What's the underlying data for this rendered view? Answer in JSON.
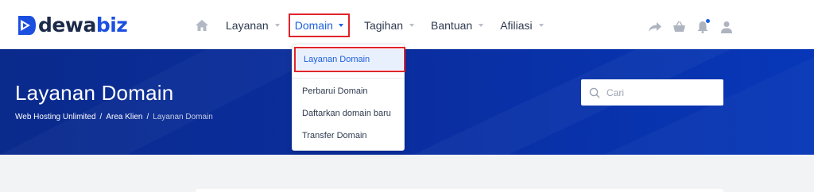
{
  "brand": {
    "name_part1": "dewa",
    "name_part2": "biz",
    "icon": "dewabiz-play-logo"
  },
  "nav": {
    "home_icon": "home-icon",
    "items": [
      {
        "label": "Layanan"
      },
      {
        "label": "Domain"
      },
      {
        "label": "Tagihan"
      },
      {
        "label": "Bantuan"
      },
      {
        "label": "Afiliasi"
      }
    ],
    "right_icons": [
      "share-arrow-icon",
      "basket-icon",
      "bell-icon",
      "user-icon"
    ]
  },
  "dropdown": {
    "items": [
      {
        "label": "Layanan Domain"
      },
      {
        "label": "Perbarui Domain"
      },
      {
        "label": "Daftarkan domain baru"
      },
      {
        "label": "Transfer Domain"
      }
    ]
  },
  "hero": {
    "title": "Layanan Domain",
    "breadcrumb": [
      "Web Hosting Unlimited",
      "Area Klien",
      "Layanan Domain"
    ],
    "breadcrumb_separator": "/"
  },
  "search": {
    "placeholder": "Cari"
  },
  "colors": {
    "accent": "#1b5fe0",
    "highlight_border": "#e0242a",
    "hero_bg": "#0a2ea0",
    "logo_dark": "#1c2a4a"
  }
}
